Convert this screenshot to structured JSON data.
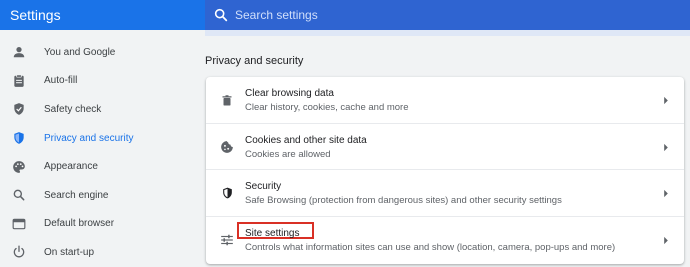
{
  "header": {
    "title": "Settings",
    "search_placeholder": "Search settings"
  },
  "colors": {
    "header_bg": "#1a73e8",
    "search_bg": "#2f64d1",
    "accent": "#1a73e8",
    "highlight_box": "#d93025"
  },
  "sidebar": {
    "items": [
      {
        "label": "You and Google",
        "icon": "person-icon"
      },
      {
        "label": "Auto-fill",
        "icon": "clipboard-icon"
      },
      {
        "label": "Safety check",
        "icon": "shield-check-icon"
      },
      {
        "label": "Privacy and security",
        "icon": "shield-icon",
        "active": true
      },
      {
        "label": "Appearance",
        "icon": "palette-icon"
      },
      {
        "label": "Search engine",
        "icon": "search-icon"
      },
      {
        "label": "Default browser",
        "icon": "browser-icon"
      },
      {
        "label": "On start-up",
        "icon": "power-icon"
      }
    ]
  },
  "main": {
    "section_title": "Privacy and security",
    "rows": [
      {
        "title": "Clear browsing data",
        "desc": "Clear history, cookies, cache and more",
        "icon": "trash-icon"
      },
      {
        "title": "Cookies and other site data",
        "desc": "Cookies are allowed",
        "icon": "cookie-icon"
      },
      {
        "title": "Security",
        "desc": "Safe Browsing (protection from dangerous sites) and other security settings",
        "icon": "security-shield-icon"
      },
      {
        "title": "Site settings",
        "desc": "Controls what information sites can use and show (location, camera, pop-ups and more)",
        "icon": "tune-icon",
        "highlighted": true
      }
    ]
  }
}
